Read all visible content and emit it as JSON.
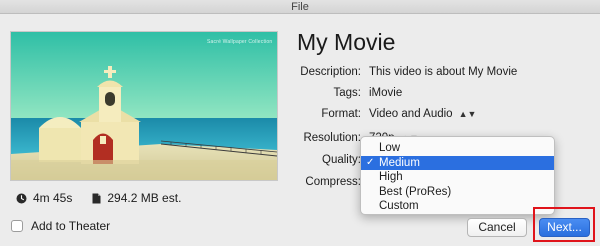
{
  "window": {
    "title": "File"
  },
  "preview": {
    "watermark": "Sacré Wallpaper Collection"
  },
  "stats": {
    "duration": "4m 45s",
    "size": "294.2 MB est."
  },
  "add_to_theater": {
    "label": "Add to Theater",
    "checked": false
  },
  "movie": {
    "title": "My Movie"
  },
  "fields": {
    "description": {
      "label": "Description:",
      "value": "This video is about My Movie"
    },
    "tags": {
      "label": "Tags:",
      "value": "iMovie"
    },
    "format": {
      "label": "Format:",
      "value": "Video and Audio"
    },
    "resolution": {
      "label": "Resolution:",
      "value": "720p"
    },
    "quality": {
      "label": "Quality:"
    },
    "compress": {
      "label": "Compress:"
    }
  },
  "quality_menu": {
    "options": [
      "Low",
      "Medium",
      "High",
      "Best (ProRes)",
      "Custom"
    ],
    "selected": "Medium"
  },
  "buttons": {
    "cancel": "Cancel",
    "next": "Next..."
  },
  "colors": {
    "accent": "#2b6fe0",
    "highlight": "#e0141b"
  }
}
